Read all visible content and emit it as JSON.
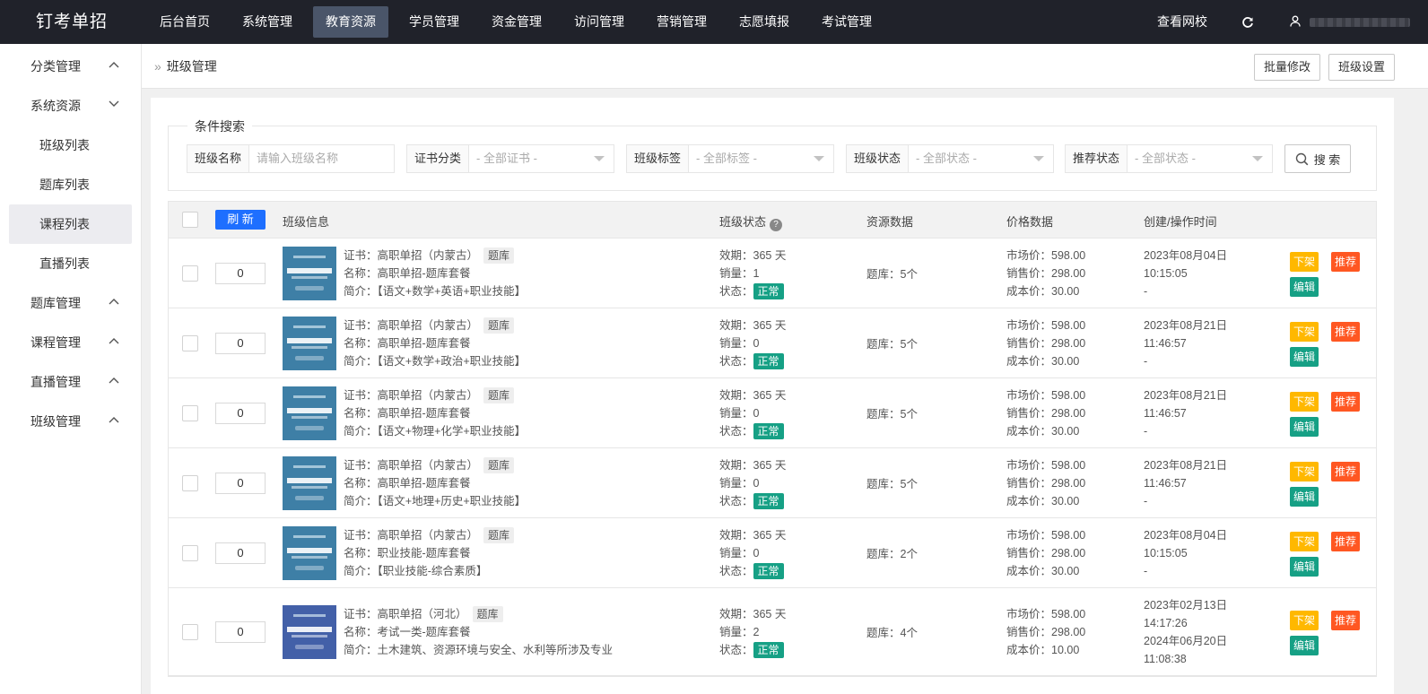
{
  "app": {
    "logo": "钉考单招"
  },
  "topnav": {
    "items": [
      {
        "label": "后台首页"
      },
      {
        "label": "系统管理"
      },
      {
        "label": "教育资源",
        "active": true
      },
      {
        "label": "学员管理"
      },
      {
        "label": "资金管理"
      },
      {
        "label": "访问管理"
      },
      {
        "label": "营销管理"
      },
      {
        "label": "志愿填报"
      },
      {
        "label": "考试管理"
      }
    ],
    "view_school": "查看网校"
  },
  "sidebar": {
    "groups": [
      {
        "label": "分类管理",
        "expanded": false
      },
      {
        "label": "系统资源",
        "expanded": true,
        "children": [
          "班级列表",
          "题库列表",
          "课程列表",
          "直播列表"
        ],
        "active_child": "课程列表"
      },
      {
        "label": "题库管理",
        "expanded": false
      },
      {
        "label": "课程管理",
        "expanded": false
      },
      {
        "label": "直播管理",
        "expanded": false
      },
      {
        "label": "班级管理",
        "expanded": false
      }
    ]
  },
  "breadcrumb": {
    "title": "班级管理",
    "batch_edit": "批量修改",
    "settings": "班级设置"
  },
  "search": {
    "legend": "条件搜索",
    "class_name_label": "班级名称",
    "class_name_placeholder": "请输入班级名称",
    "cert_label": "证书分类",
    "cert_value": "- 全部证书 -",
    "tag_label": "班级标签",
    "tag_value": "- 全部标签 -",
    "status_label": "班级状态",
    "status_value": "- 全部状态 -",
    "rec_label": "推荐状态",
    "rec_value": "- 全部状态 -",
    "button": "搜 索"
  },
  "table": {
    "refresh": "刷 新",
    "headers": {
      "info": "班级信息",
      "status": "班级状态",
      "resource": "资源数据",
      "price": "价格数据",
      "time": "创建/操作时间"
    },
    "labels": {
      "cert": "证书：",
      "name": "名称：",
      "intro": "简介：",
      "validity": "效期：",
      "sales": "销量：",
      "state": "状态：",
      "market": "市场价：",
      "sale_price": "销售价：",
      "cost": "成本价："
    },
    "ops": {
      "down": "下架",
      "recommend": "推荐",
      "edit": "编辑"
    },
    "rows": [
      {
        "sort": "0",
        "cert": "高职单招（内蒙古）",
        "tag": "题库",
        "name": "高职单招-题库套餐",
        "intro": "【语文+数学+英语+职业技能】",
        "validity": "365 天",
        "sales": "1",
        "state": "正常",
        "resource": "题库：5个",
        "market": "598.00",
        "sale_price": "298.00",
        "cost": "30.00",
        "created": "2023年08月04日",
        "created_time": "10:15:05",
        "updated": "-",
        "thumb_color": "#3e7fa6"
      },
      {
        "sort": "0",
        "cert": "高职单招（内蒙古）",
        "tag": "题库",
        "name": "高职单招-题库套餐",
        "intro": "【语文+数学+政治+职业技能】",
        "validity": "365 天",
        "sales": "0",
        "state": "正常",
        "resource": "题库：5个",
        "market": "598.00",
        "sale_price": "298.00",
        "cost": "30.00",
        "created": "2023年08月21日",
        "created_time": "11:46:57",
        "updated": "-",
        "thumb_color": "#3e7fa6"
      },
      {
        "sort": "0",
        "cert": "高职单招（内蒙古）",
        "tag": "题库",
        "name": "高职单招-题库套餐",
        "intro": "【语文+物理+化学+职业技能】",
        "validity": "365 天",
        "sales": "0",
        "state": "正常",
        "resource": "题库：5个",
        "market": "598.00",
        "sale_price": "298.00",
        "cost": "30.00",
        "created": "2023年08月21日",
        "created_time": "11:46:57",
        "updated": "-",
        "thumb_color": "#3e7fa6"
      },
      {
        "sort": "0",
        "cert": "高职单招（内蒙古）",
        "tag": "题库",
        "name": "高职单招-题库套餐",
        "intro": "【语文+地理+历史+职业技能】",
        "validity": "365 天",
        "sales": "0",
        "state": "正常",
        "resource": "题库：5个",
        "market": "598.00",
        "sale_price": "298.00",
        "cost": "30.00",
        "created": "2023年08月21日",
        "created_time": "11:46:57",
        "updated": "-",
        "thumb_color": "#3e7fa6"
      },
      {
        "sort": "0",
        "cert": "高职单招（内蒙古）",
        "tag": "题库",
        "name": "职业技能-题库套餐",
        "intro": "【职业技能-综合素质】",
        "validity": "365 天",
        "sales": "0",
        "state": "正常",
        "resource": "题库：2个",
        "market": "598.00",
        "sale_price": "298.00",
        "cost": "30.00",
        "created": "2023年08月04日",
        "created_time": "10:15:05",
        "updated": "-",
        "thumb_color": "#3e7fa6"
      },
      {
        "sort": "0",
        "cert": "高职单招（河北）",
        "tag": "题库",
        "name": "考试一类-题库套餐",
        "intro": "土木建筑、资源环境与安全、水利等所涉及专业",
        "validity": "365 天",
        "sales": "2",
        "state": "正常",
        "resource": "题库：4个",
        "market": "598.00",
        "sale_price": "298.00",
        "cost": "10.00",
        "created": "2023年02月13日",
        "created_time": "14:17:26",
        "updated": "2024年06月20日",
        "updated_time": "11:08:38",
        "thumb_color": "#4360a8"
      }
    ]
  }
}
